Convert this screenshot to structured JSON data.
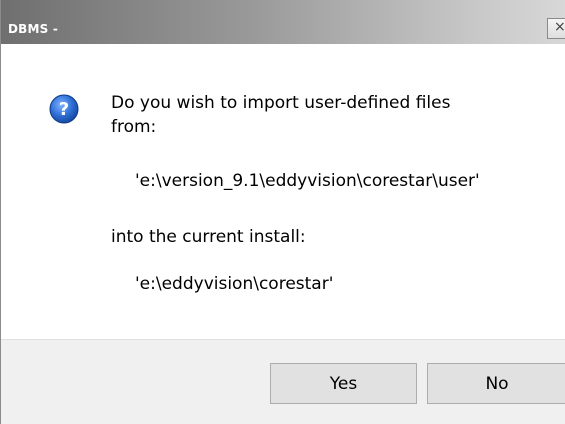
{
  "window": {
    "title": "DBMS -",
    "close_glyph": "×"
  },
  "message": {
    "line1": "Do you wish to import user-defined files",
    "line2": "from:",
    "source_path": "'e:\\version_9.1\\eddyvision\\corestar\\user'",
    "line3": "into the current install:",
    "target_path": "'e:\\eddyvision\\corestar'"
  },
  "icon": {
    "name": "question-icon",
    "color": "#1f5fbf"
  },
  "buttons": {
    "yes_label": "Yes",
    "no_label": "No"
  },
  "colors": {
    "titlebar_dark": "#6f6f6f",
    "titlebar_light": "#d8d8d8",
    "footer_bg": "#f0f0f0",
    "button_bg": "#e1e1e1"
  }
}
